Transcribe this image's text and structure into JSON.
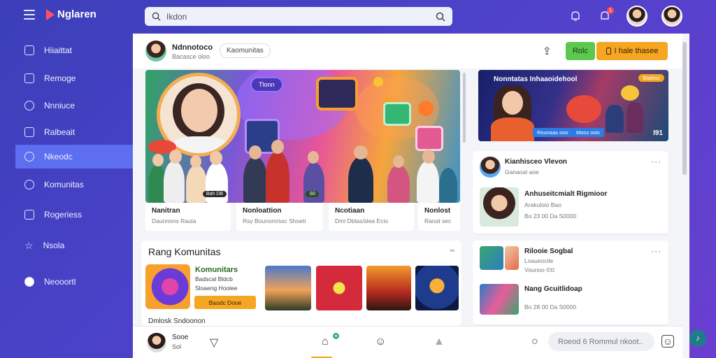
{
  "app": {
    "name": "Nglaren"
  },
  "search": {
    "value": "Ikdon"
  },
  "topbar": {
    "notification_count": "1"
  },
  "sidebar": {
    "items": [
      {
        "label": "Hiiaittat",
        "icon": "home-icon"
      },
      {
        "label": "Remoge",
        "icon": "calendar-icon"
      },
      {
        "label": "Nnniuce",
        "icon": "compass-icon"
      },
      {
        "label": "Ralbeait",
        "icon": "users-icon"
      },
      {
        "label": "Nkeodc",
        "icon": "chat-icon",
        "active": true
      },
      {
        "label": "Komunitas",
        "icon": "shield-icon"
      },
      {
        "label": "Rogeriess",
        "icon": "box-icon"
      },
      {
        "label": "Nsola",
        "icon": "star-icon"
      },
      {
        "label": "Neooortl",
        "icon": "badge-icon"
      }
    ]
  },
  "header": {
    "title": "Ndnnotoco",
    "subtitle": "Bacasce oloo",
    "tag": "Kaomunitas",
    "btn_green": "Rolc",
    "btn_orange": "I hale thasee"
  },
  "hero": {
    "tag": "Tlonn",
    "cards": [
      {
        "title": "Nanitran",
        "sub": "Daunnnns Raula",
        "badge": "Bah DB"
      },
      {
        "title": "Nonloattion",
        "sub": "Rsy Bounom/ssc Shoeti",
        "badge": "S0"
      },
      {
        "title": "Ncotiaan",
        "sub": "Dmi Dblas/slea Ecio",
        "badge": ""
      },
      {
        "title": "Nonlost",
        "sub": "Ranat sec",
        "badge": ""
      }
    ]
  },
  "promo": {
    "title": "Nonntatas Inhaaoidehool",
    "badge": "Btalesc",
    "btn1": "Rounaas ooo",
    "btn2": "Moos ooic",
    "number": "I91"
  },
  "feed1": {
    "header_title": "Kianhisceo Vlevon",
    "header_sub": "Ganaoal aoe",
    "post_title": "Anhuseitcmialt Rigmioor",
    "post_sub1": "Arakuloio Bao",
    "post_stats": "Bo 23 00 Da S0000"
  },
  "feed2": {
    "item1_title": "Rilooie Sogbal",
    "item1_sub1": "Loaueocile",
    "item1_sub2": "Vounoo ©0:",
    "item2_title": "Nang Gcuitlidoap",
    "item2_stats": "Bo 28 00 Da S0000"
  },
  "ranking": {
    "title": "Rang Komunitas",
    "expand": "ᵉˢ",
    "name": "Komunitars",
    "stat1": "Badscal Bldcb",
    "stat2": "Sloaeng Hoolee",
    "join": "Baodc Dooe",
    "footer": "Dmlosk Sndoonon"
  },
  "bottom": {
    "name": "Sooe",
    "sub": "Sol",
    "input_placeholder": "Roeod 6 Rommul nkoot..",
    "badge": "●",
    "fab": "♪"
  }
}
